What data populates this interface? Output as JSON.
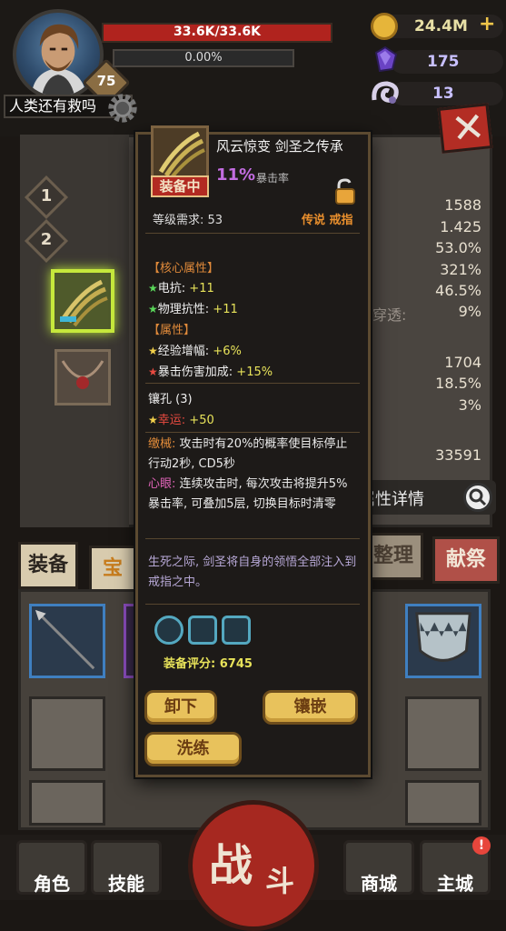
{
  "player": {
    "name": "人类还有救吗",
    "level": "75",
    "hp_text": "33.6K/33.6K",
    "hp_fraction": 1.0,
    "xp_text": "0.00%",
    "xp_fraction": 0.0
  },
  "currencies": {
    "gold": "24.4M",
    "gold_plus": "+",
    "gem": "175",
    "horn": "13"
  },
  "side_nav": {
    "item1": "1",
    "item2": "2"
  },
  "background_stats": {
    "values": [
      "1588",
      "1.425",
      "53.0%",
      "321%",
      "46.5%",
      "9%",
      "1704",
      "18.5%",
      "3%",
      "33591"
    ],
    "partial_label": "穿透:",
    "detail_button": "属性详情"
  },
  "tabs": {
    "equip": "装备",
    "treasure": "宝",
    "sort": "整理",
    "sacrifice": "献祭"
  },
  "bottom_nav": {
    "role": "角色",
    "skill": "技能",
    "battle_1": "战",
    "battle_2": "斗",
    "shop": "商城",
    "main_city": "主城",
    "notify": "!"
  },
  "item": {
    "name": "风云惊变 剑圣之传承",
    "equipped_tag": "装备中",
    "crit_pct": "11%",
    "crit_label": "暴击率",
    "level_req": "等级需求: 53",
    "rarity": "传说 戒指",
    "core_title": "【核心属性】",
    "core_attrs": [
      {
        "name": "电抗:",
        "value": "+11"
      },
      {
        "name": "物理抗性:",
        "value": "+11"
      }
    ],
    "attr_title": "【属性】",
    "attrs": [
      {
        "name": "经验增幅:",
        "value": "+6%",
        "star": "gold"
      },
      {
        "name": "暴击伤害加成:",
        "value": "+15%",
        "star": "red"
      }
    ],
    "socket_title": "镶孔 (3)",
    "socket_attr": {
      "name": "幸运:",
      "value": "+50"
    },
    "skill1_name": "缴械:",
    "skill1_text": "攻击时有20%的概率使目标停止行动2秒, CD5秒",
    "skill2_name": "心眼:",
    "skill2_text": "连续攻击时, 每次攻击将提升5%暴击率, 可叠加5层, 切换目标时清零",
    "lore": "生死之际, 剑圣将自身的领悟全部注入到戒指之中。",
    "score": "装备评分: 6745",
    "btn_unequip": "卸下",
    "btn_inlay": "镶嵌",
    "btn_reforge": "洗练"
  },
  "colors": {
    "hp": "#b0231e",
    "equipped_glow": "#c6e83c",
    "popup_border": "#5c4a31",
    "button_gold": "#e8c25c",
    "battle_red": "#a62820"
  }
}
